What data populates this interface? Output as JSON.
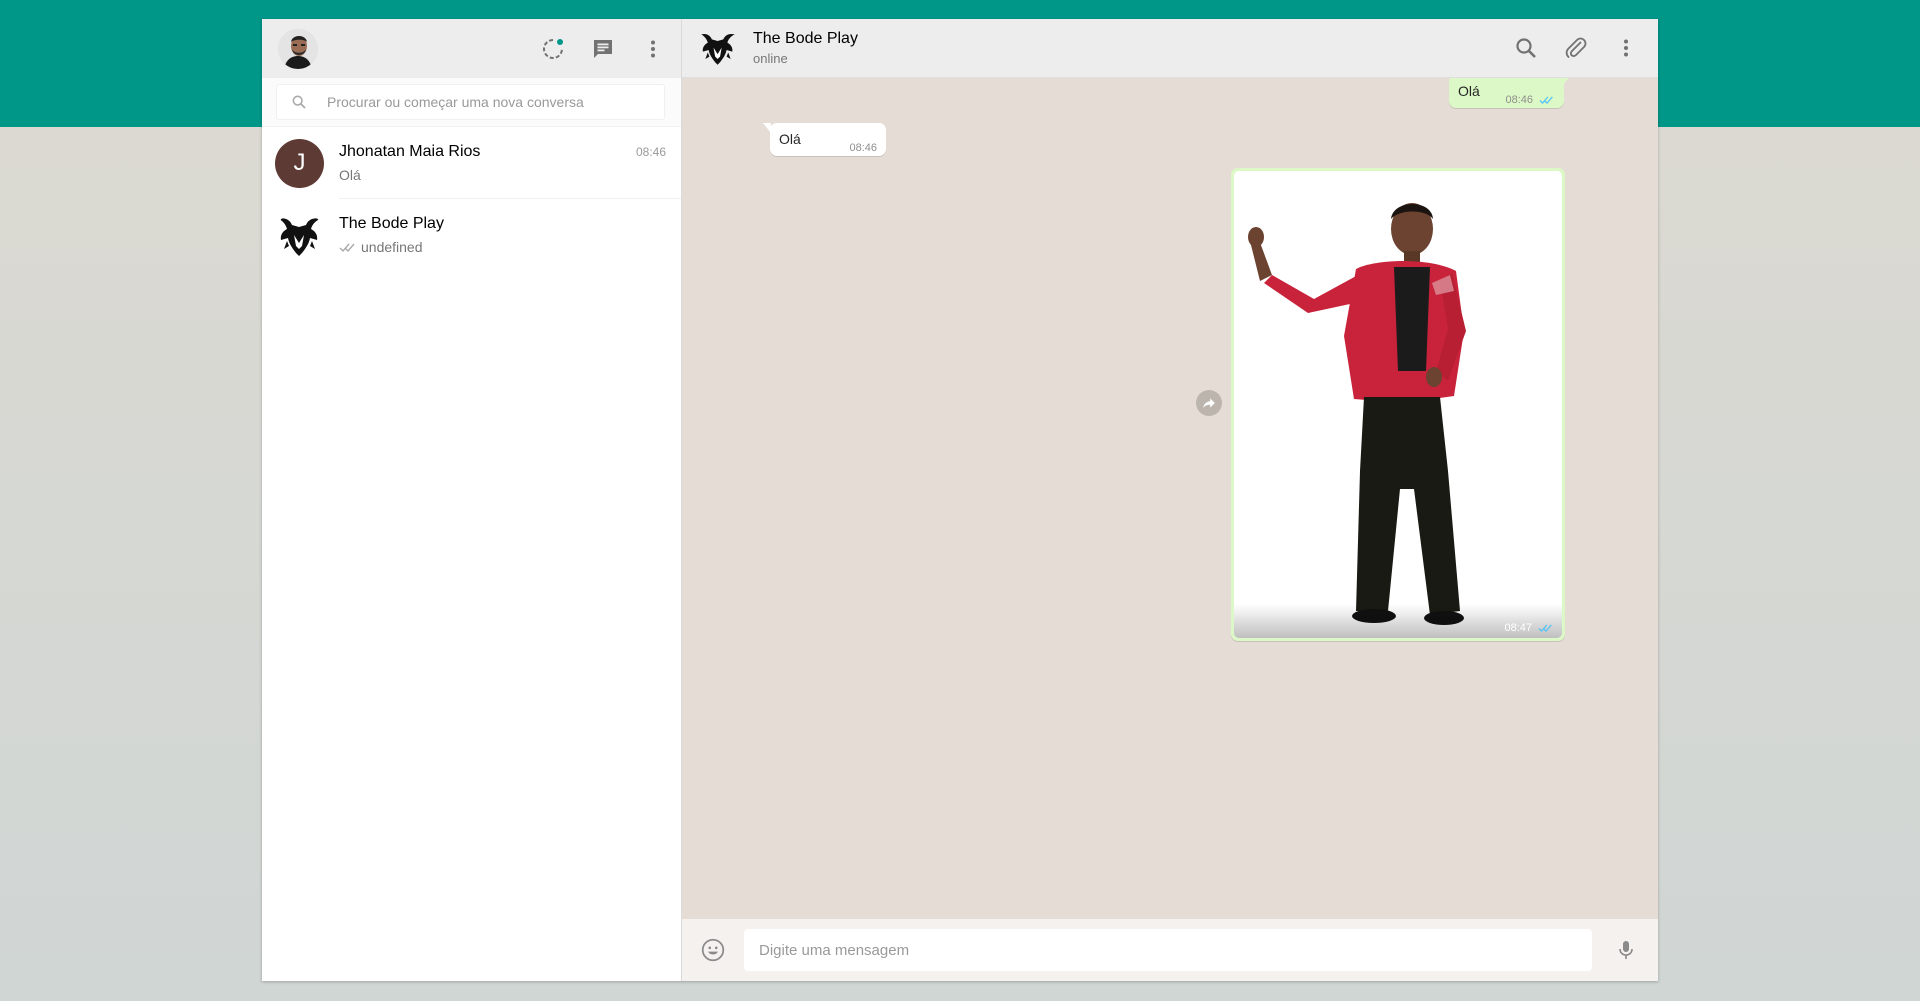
{
  "sidebar": {
    "search": {
      "placeholder": "Procurar ou começar uma nova conversa"
    },
    "chats": [
      {
        "name": "Jhonatan Maia Rios",
        "initial": "J",
        "time": "08:46",
        "preview": "Olá"
      },
      {
        "name": "The Bode Play",
        "time": "",
        "preview": "undefined"
      }
    ]
  },
  "conversation": {
    "contact_name": "The Bode Play",
    "contact_status": "online",
    "messages": [
      {
        "direction": "out",
        "text": "Olá",
        "time": "08:46"
      },
      {
        "direction": "in",
        "text": "Olá",
        "time": "08:46"
      },
      {
        "direction": "out",
        "type": "image",
        "time": "08:47"
      }
    ],
    "compose_placeholder": "Digite uma mensagem"
  },
  "icons": {
    "status": "status-icon",
    "new_chat": "new-chat-icon",
    "menu": "menu-icon",
    "search": "search-icon",
    "attach": "paperclip-icon",
    "emoji": "emoji-icon",
    "mic": "microphone-icon",
    "forward": "forward-icon",
    "read": "double-check-icon"
  },
  "colors": {
    "brand_teal": "#009688",
    "outgoing_bubble": "#dcf8c6",
    "chat_background": "#e5ddd5",
    "read_tick": "#4fc3f7",
    "avatar_letter_bg": "#5d3a33"
  }
}
